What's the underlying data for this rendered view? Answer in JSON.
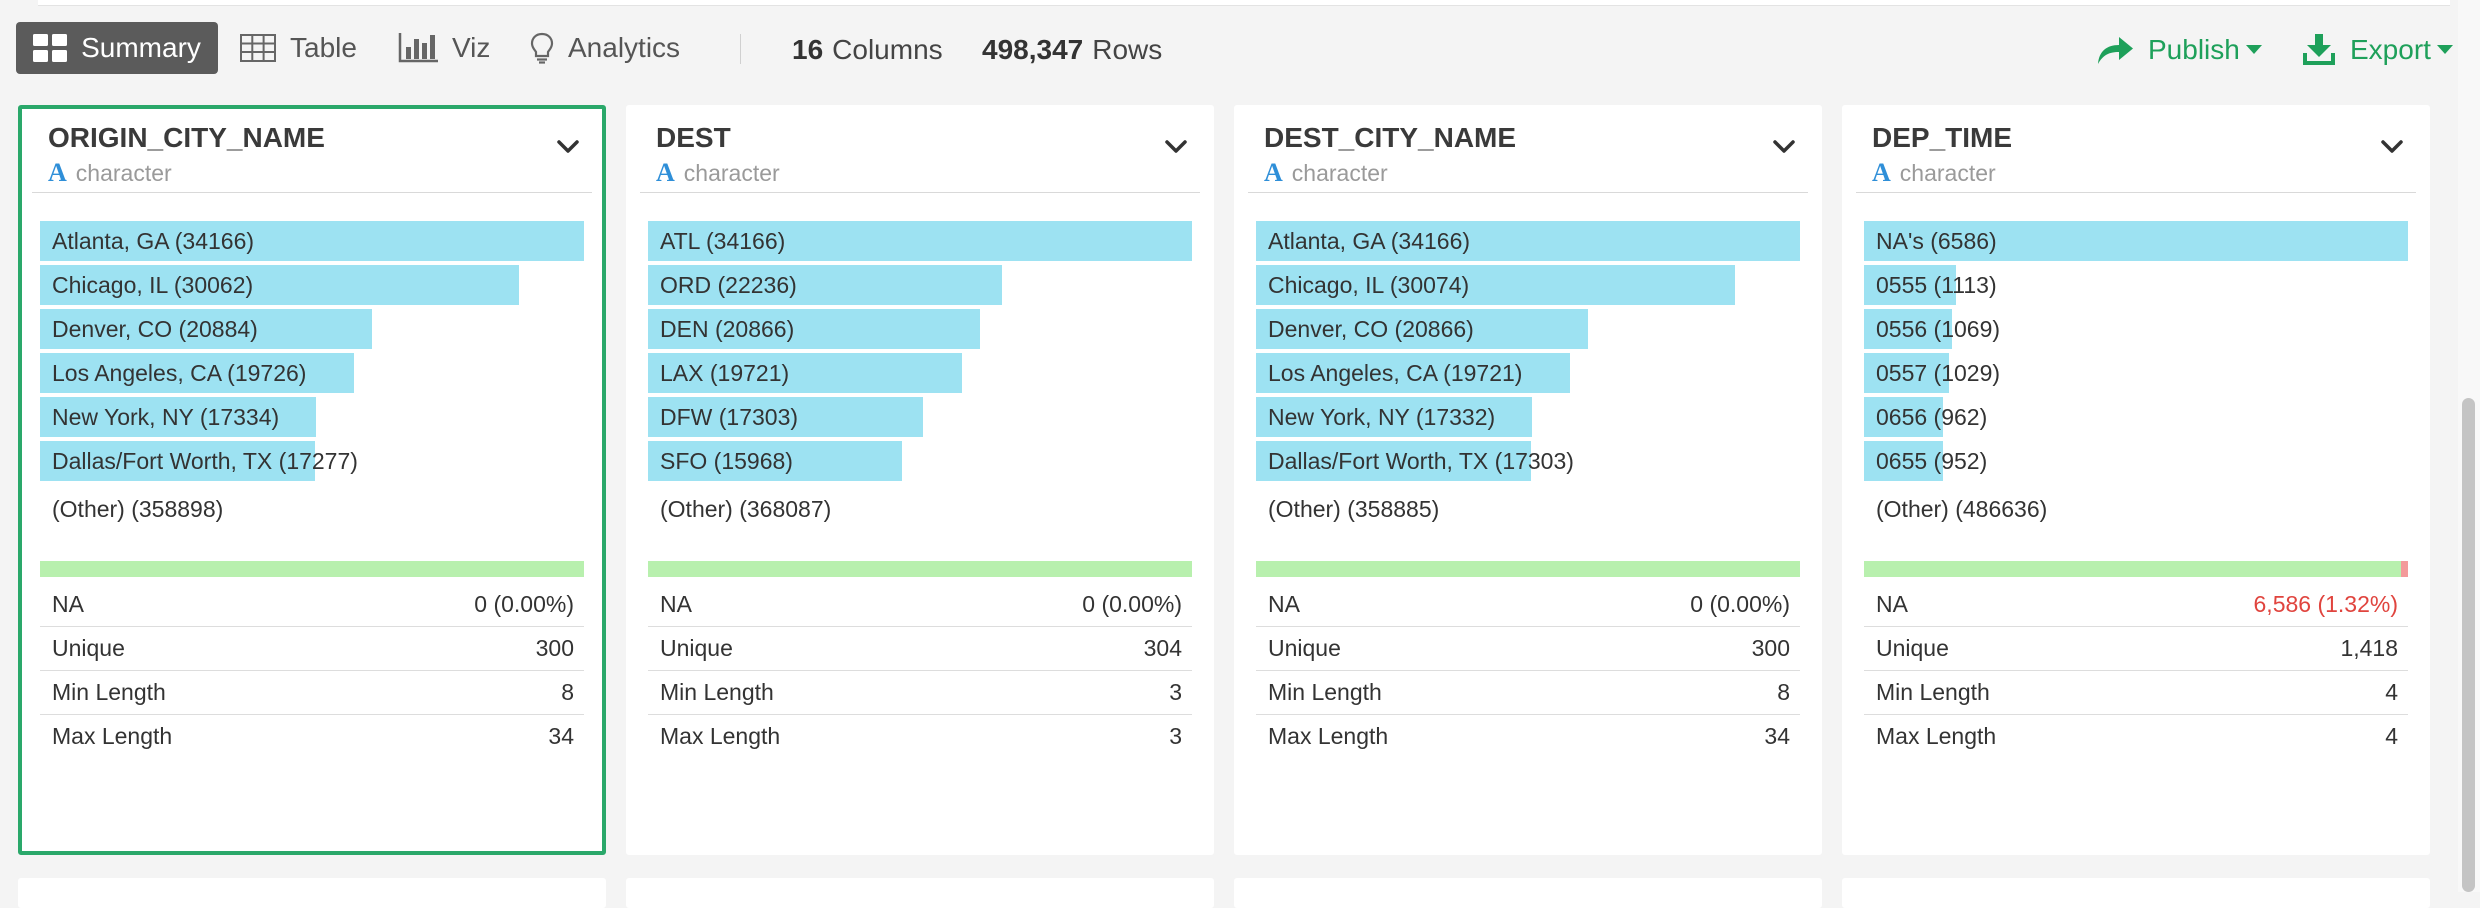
{
  "toolbar": {
    "summary_label": "Summary",
    "table_label": "Table",
    "viz_label": "Viz",
    "analytics_label": "Analytics",
    "columns_count": "16",
    "columns_label": "Columns",
    "rows_count": "498,347",
    "rows_label": "Rows",
    "publish_label": "Publish",
    "export_label": "Export",
    "accent_color": "#1ea05a"
  },
  "cards": [
    {
      "title": "ORIGIN_CITY_NAME",
      "type": "character",
      "icon": "A",
      "selected": true,
      "top_values": [
        {
          "label": "Atlanta, GA (34166)",
          "frac": 1.0
        },
        {
          "label": "Chicago, IL (30062)",
          "frac": 0.88
        },
        {
          "label": "Denver, CO (20884)",
          "frac": 0.611
        },
        {
          "label": "Los Angeles, CA (19726)",
          "frac": 0.577
        },
        {
          "label": "New York, NY (17334)",
          "frac": 0.507
        },
        {
          "label": "Dallas/Fort Worth, TX (17277)",
          "frac": 0.506
        }
      ],
      "other": "(Other) (358898)",
      "na_frac": 0,
      "stats": {
        "na_label": "NA",
        "na_value": "0 (0.00%)",
        "unique_label": "Unique",
        "unique_value": "300",
        "min_label": "Min Length",
        "min_value": "8",
        "max_label": "Max Length",
        "max_value": "34"
      }
    },
    {
      "title": "DEST",
      "type": "character",
      "icon": "A",
      "selected": false,
      "top_values": [
        {
          "label": "ATL (34166)",
          "frac": 1.0
        },
        {
          "label": "ORD (22236)",
          "frac": 0.651
        },
        {
          "label": "DEN (20866)",
          "frac": 0.611
        },
        {
          "label": "LAX (19721)",
          "frac": 0.577
        },
        {
          "label": "DFW (17303)",
          "frac": 0.506
        },
        {
          "label": "SFO (15968)",
          "frac": 0.467
        }
      ],
      "other": "(Other) (368087)",
      "na_frac": 0,
      "stats": {
        "na_label": "NA",
        "na_value": "0 (0.00%)",
        "unique_label": "Unique",
        "unique_value": "304",
        "min_label": "Min Length",
        "min_value": "3",
        "max_label": "Max Length",
        "max_value": "3"
      }
    },
    {
      "title": "DEST_CITY_NAME",
      "type": "character",
      "icon": "A",
      "selected": false,
      "top_values": [
        {
          "label": "Atlanta, GA (34166)",
          "frac": 1.0
        },
        {
          "label": "Chicago, IL (30074)",
          "frac": 0.88
        },
        {
          "label": "Denver, CO (20866)",
          "frac": 0.611
        },
        {
          "label": "Los Angeles, CA (19721)",
          "frac": 0.577
        },
        {
          "label": "New York, NY (17332)",
          "frac": 0.507
        },
        {
          "label": "Dallas/Fort Worth, TX (17303)",
          "frac": 0.506
        }
      ],
      "other": "(Other) (358885)",
      "na_frac": 0,
      "stats": {
        "na_label": "NA",
        "na_value": "0 (0.00%)",
        "unique_label": "Unique",
        "unique_value": "300",
        "min_label": "Min Length",
        "min_value": "8",
        "max_label": "Max Length",
        "max_value": "34"
      }
    },
    {
      "title": "DEP_TIME",
      "type": "character",
      "icon": "A",
      "selected": false,
      "top_values": [
        {
          "label": "NA's (6586)",
          "frac": 1.0
        },
        {
          "label": "0555 (1113)",
          "frac": 0.169
        },
        {
          "label": "0556 (1069)",
          "frac": 0.162
        },
        {
          "label": "0557 (1029)",
          "frac": 0.156
        },
        {
          "label": "0656 (962)",
          "frac": 0.146
        },
        {
          "label": "0655 (952)",
          "frac": 0.145
        }
      ],
      "other": "(Other) (486636)",
      "na_frac": 0.0132,
      "stats": {
        "na_label": "NA",
        "na_value": "6,586 (1.32%)",
        "unique_label": "Unique",
        "unique_value": "1,418",
        "min_label": "Min Length",
        "min_value": "4",
        "max_label": "Max Length",
        "max_value": "4"
      }
    }
  ]
}
